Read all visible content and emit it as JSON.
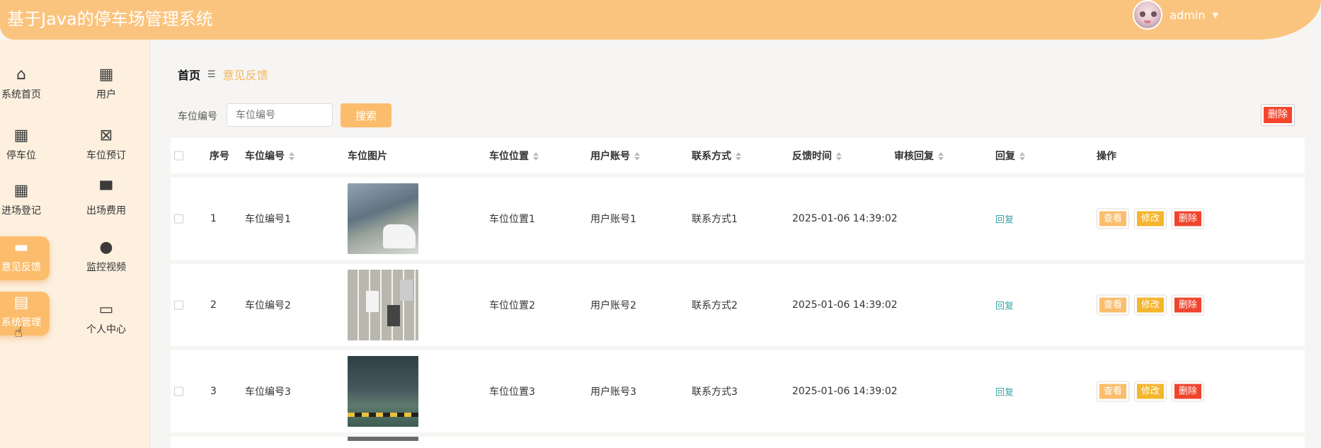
{
  "app": {
    "title": "基于Java的停车场管理系统"
  },
  "user": {
    "name": "admin"
  },
  "sidebar": {
    "items": [
      {
        "label": "系统首页",
        "icon": "home-icon",
        "active": false
      },
      {
        "label": "用户",
        "icon": "grid-icon",
        "active": false
      },
      {
        "label": "停车位",
        "icon": "grid-icon",
        "active": false
      },
      {
        "label": "车位预订",
        "icon": "clipboard-x-icon",
        "active": false
      },
      {
        "label": "进场登记",
        "icon": "grid-icon",
        "active": false
      },
      {
        "label": "出场费用",
        "icon": "brush-icon",
        "active": false
      },
      {
        "label": "意见反馈",
        "icon": "wallet-icon",
        "active": true
      },
      {
        "label": "监控视频",
        "icon": "person-icon",
        "active": false
      },
      {
        "label": "系统管理",
        "icon": "clipboard-icon",
        "active": true
      },
      {
        "label": "个人中心",
        "icon": "card-icon",
        "active": false
      }
    ]
  },
  "breadcrumb": {
    "home": "首页",
    "separator": "☰",
    "current": "意见反馈"
  },
  "search": {
    "label": "车位编号",
    "placeholder": "车位编号",
    "button": "搜索"
  },
  "toolbar": {
    "delete_label": "删除"
  },
  "table": {
    "headers": {
      "index": "序号",
      "space_no": "车位编号",
      "image": "车位图片",
      "location": "车位位置",
      "account": "用户账号",
      "contact": "联系方式",
      "time": "反馈时间",
      "review": "审核回复",
      "reply": "回复",
      "actions": "操作"
    },
    "rows": [
      {
        "index": "1",
        "space_no": "车位编号1",
        "location": "车位位置1",
        "account": "用户账号1",
        "contact": "联系方式1",
        "time": "2025-01-06 14:39:02",
        "reply": "回复"
      },
      {
        "index": "2",
        "space_no": "车位编号2",
        "location": "车位位置2",
        "account": "用户账号2",
        "contact": "联系方式2",
        "time": "2025-01-06 14:39:02",
        "reply": "回复"
      },
      {
        "index": "3",
        "space_no": "车位编号3",
        "location": "车位位置3",
        "account": "用户账号3",
        "contact": "联系方式3",
        "time": "2025-01-06 14:39:02",
        "reply": "回复"
      }
    ],
    "actions": {
      "view": "查看",
      "edit": "修改",
      "delete": "删除"
    }
  },
  "colors": {
    "accent": "#fbbd6c",
    "header": "#fbc47e",
    "danger": "#f0442d",
    "warning": "#f5b52c",
    "link": "#3aa6a6"
  }
}
